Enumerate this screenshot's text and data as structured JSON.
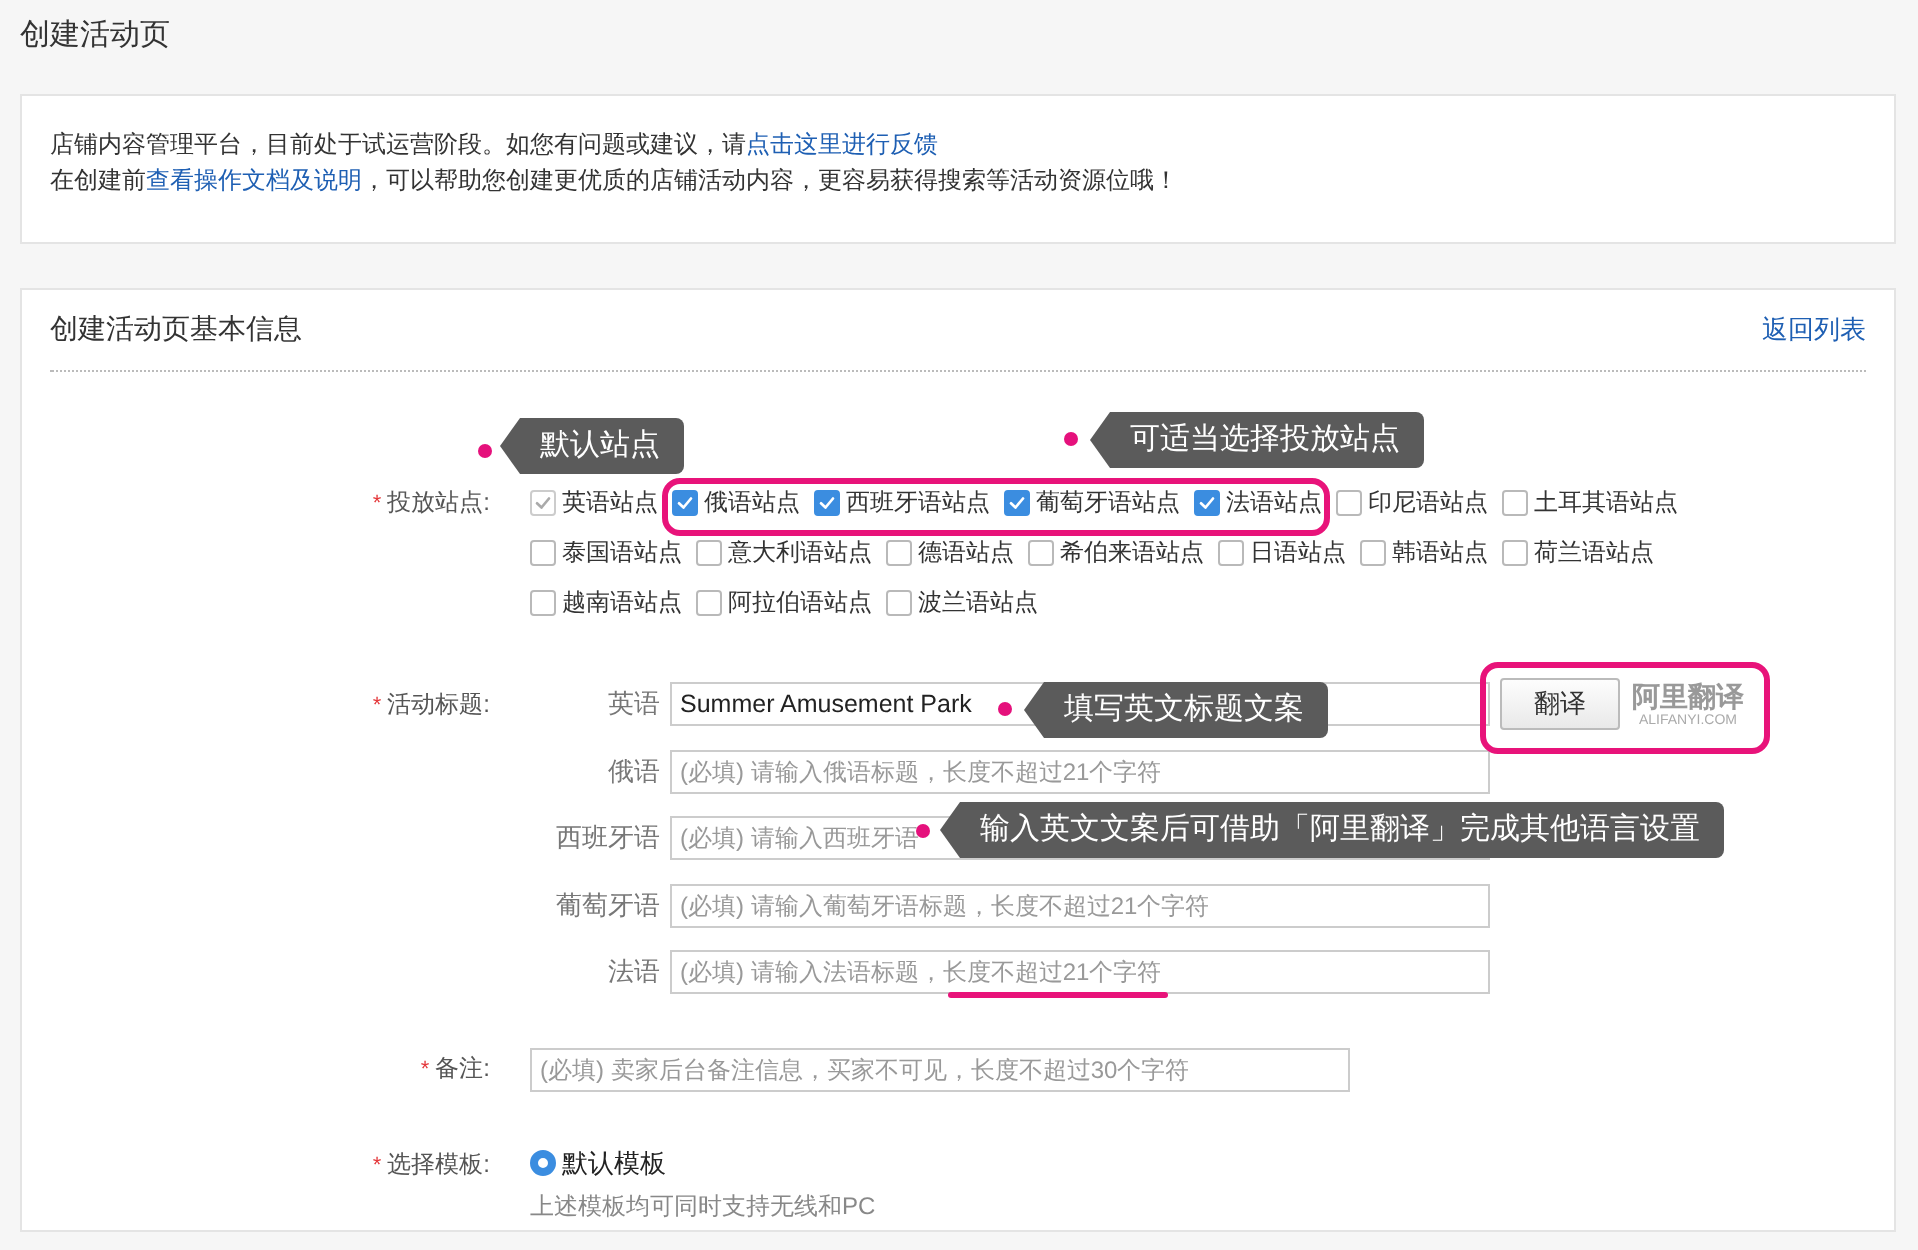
{
  "page_title": "创建活动页",
  "notice": [
    [
      {
        "kind": "text",
        "text": "店铺内容管理平台，目前处于试运营阶段。如您有问题或建议，请"
      },
      {
        "kind": "link",
        "text": "点击这里进行反馈"
      }
    ],
    [
      {
        "kind": "text",
        "text": "在创建前"
      },
      {
        "kind": "link",
        "text": "查看操作文档及说明"
      },
      {
        "kind": "text",
        "text": "，可以帮助您创建更优质的店铺活动内容，更容易获得搜索等活动资源位哦！"
      }
    ]
  ],
  "form": {
    "title": "创建活动页基本信息",
    "back_link": "返回列表",
    "sites": {
      "mark": "*",
      "label": "投放站点:",
      "rows": [
        [
          {
            "label": "英语站点",
            "checked": true,
            "disabled": true
          },
          {
            "label": "俄语站点",
            "checked": true,
            "disabled": false
          },
          {
            "label": "西班牙语站点",
            "checked": true,
            "disabled": false
          },
          {
            "label": "葡萄牙语站点",
            "checked": true,
            "disabled": false
          },
          {
            "label": "法语站点",
            "checked": true,
            "disabled": false
          },
          {
            "label": "印尼语站点",
            "checked": false,
            "disabled": false
          },
          {
            "label": "土耳其语站点",
            "checked": false,
            "disabled": false
          }
        ],
        [
          {
            "label": "泰国语站点",
            "checked": false,
            "disabled": false
          },
          {
            "label": "意大利语站点",
            "checked": false,
            "disabled": false
          },
          {
            "label": "德语站点",
            "checked": false,
            "disabled": false
          },
          {
            "label": "希伯来语站点",
            "checked": false,
            "disabled": false
          },
          {
            "label": "日语站点",
            "checked": false,
            "disabled": false
          },
          {
            "label": "韩语站点",
            "checked": false,
            "disabled": false
          },
          {
            "label": "荷兰语站点",
            "checked": false,
            "disabled": false
          }
        ],
        [
          {
            "label": "越南语站点",
            "checked": false,
            "disabled": false
          },
          {
            "label": "阿拉伯语站点",
            "checked": false,
            "disabled": false
          },
          {
            "label": "波兰语站点",
            "checked": false,
            "disabled": false
          }
        ]
      ]
    },
    "titles": {
      "mark": "*",
      "label": "活动标题:",
      "rows": [
        {
          "language": "英语",
          "value": "Summer Amusement Park"
        },
        {
          "language": "俄语",
          "placeholder": "(必填) 请输入俄语标题，长度不超过21个字符"
        },
        {
          "language": "西班牙语",
          "placeholder": "(必填) 请输入西班牙语"
        },
        {
          "language": "葡萄牙语",
          "placeholder": "(必填) 请输入葡萄牙语标题，长度不超过21个字符"
        },
        {
          "language": "法语",
          "placeholder": "(必填) 请输入法语标题，长度不超过21个字符"
        }
      ],
      "translate_button": "翻译",
      "logo_name": "阿里翻译",
      "logo_domain": "ALIFANYI.COM"
    },
    "remark": {
      "mark": "*",
      "label": "备注:",
      "placeholder": "(必填) 卖家后台备注信息，买家不可见，长度不超过30个字符"
    },
    "template": {
      "mark": "*",
      "label": "选择模板:",
      "options": [
        {
          "label": "默认模板",
          "selected": true
        }
      ],
      "hint": "上述模板均可同时支持无线和PC"
    }
  },
  "annotations": [
    {
      "text": "默认站点"
    },
    {
      "text": "可适当选择投放站点"
    },
    {
      "text": "填写英文标题文案"
    },
    {
      "text": "输入英文文案后可借助「阿里翻译」完成其他语言设置"
    }
  ]
}
